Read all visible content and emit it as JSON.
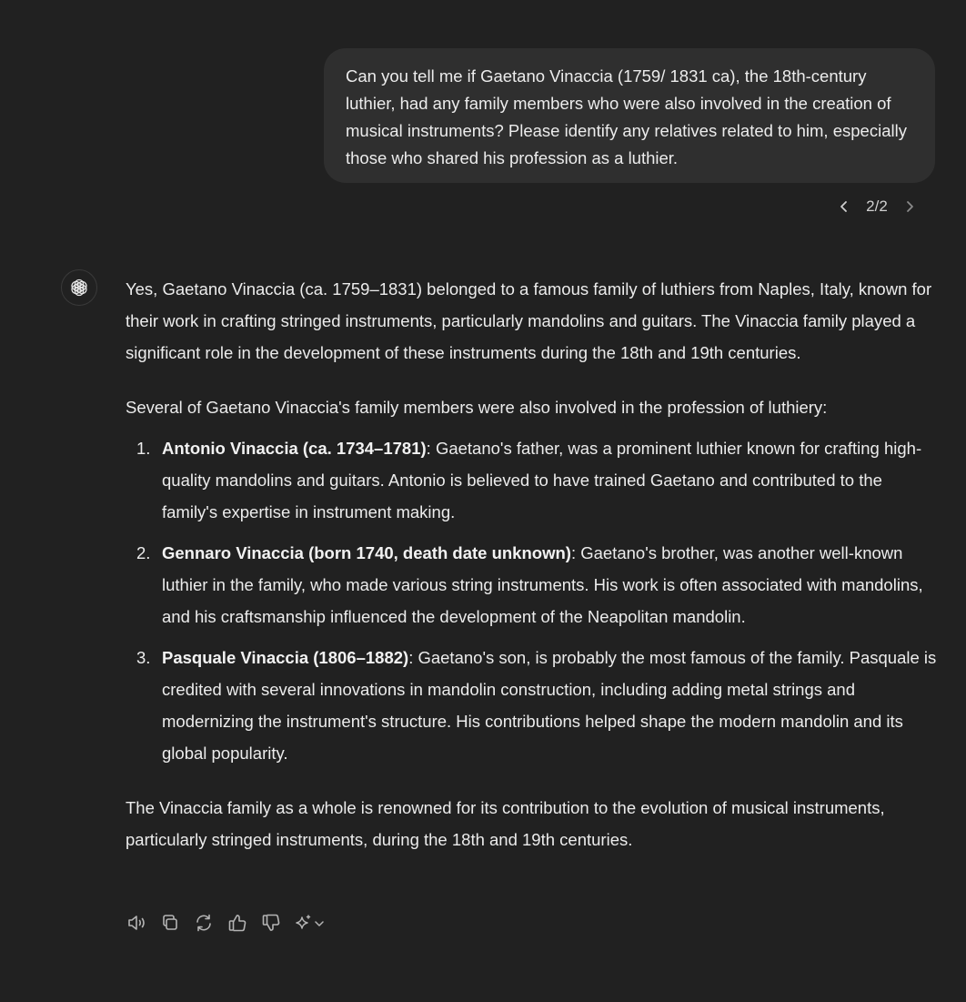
{
  "user_message": {
    "text": "Can you tell me if Gaetano Vinaccia (1759/ 1831 ca), the 18th-century luthier, had any family members who were also involved in the creation of musical instruments? Please identify any relatives related to him, especially those who shared his profession as a luthier."
  },
  "pager": {
    "label": "2/2",
    "prev_icon": "chevron-left-icon",
    "next_icon": "chevron-right-icon"
  },
  "assistant": {
    "avatar_icon": "openai-logo-icon",
    "intro": "Yes, Gaetano Vinaccia (ca. 1759–1831) belonged to a famous family of luthiers from Naples, Italy, known for their work in crafting stringed instruments, particularly mandolins and guitars. The Vinaccia family played a significant role in the development of these instruments during the 18th and 19th centuries.",
    "lead": "Several of Gaetano Vinaccia's family members were also involved in the profession of luthiery:",
    "items": [
      {
        "number": "1.",
        "name": "Antonio Vinaccia (ca. 1734–1781)",
        "text": ": Gaetano's father, was a prominent luthier known for crafting high-quality mandolins and guitars. Antonio is believed to have trained Gaetano and contributed to the family's expertise in instrument making."
      },
      {
        "number": "2.",
        "name": "Gennaro Vinaccia (born 1740, death date unknown)",
        "text": ": Gaetano's brother, was another well-known luthier in the family, who made various string instruments. His work is often associated with mandolins, and his craftsmanship influenced the development of the Neapolitan mandolin."
      },
      {
        "number": "3.",
        "name": "Pasquale Vinaccia (1806–1882)",
        "text": ": Gaetano's son, is probably the most famous of the family. Pasquale is credited with several innovations in mandolin construction, including adding metal strings and modernizing the instrument's structure. His contributions helped shape the modern mandolin and its global popularity."
      }
    ],
    "conclusion": "The Vinaccia family as a whole is renowned for its contribution to the evolution of musical instruments, particularly stringed instruments, during the 18th and 19th centuries."
  },
  "action_bar": {
    "icons": [
      "read-aloud-icon",
      "copy-icon",
      "regenerate-icon",
      "thumbs-up-icon",
      "thumbs-down-icon",
      "sparkle-model-icon"
    ]
  },
  "colors": {
    "background": "#212121",
    "user_bubble": "#2f2f2f",
    "text": "#ececec",
    "icon": "#b4b4b4"
  }
}
